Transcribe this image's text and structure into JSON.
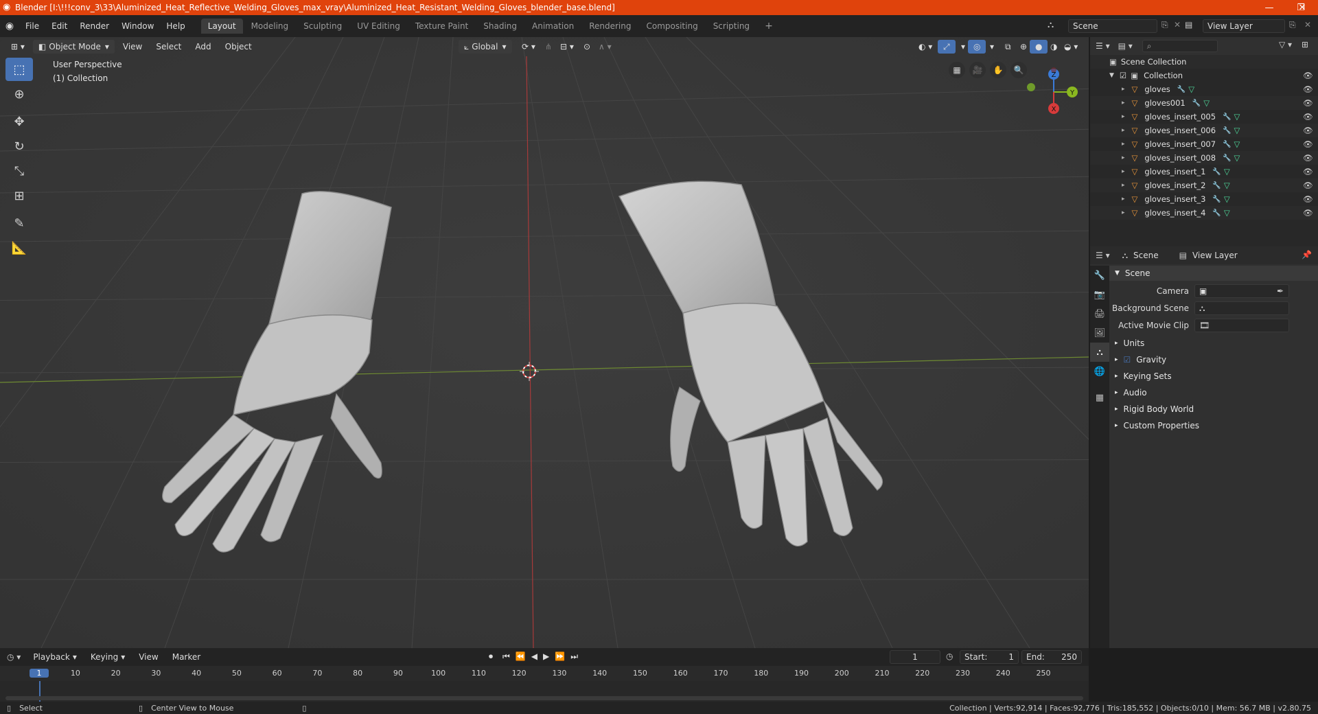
{
  "titlebar": {
    "title": "Blender [I:\\!!!conv_3\\33\\Aluminized_Heat_Reflective_Welding_Gloves_max_vray\\Aluminized_Heat_Resistant_Welding_Gloves_blender_base.blend]",
    "minimize": "—",
    "maximize": "❐",
    "close": "✕"
  },
  "menus": [
    "File",
    "Edit",
    "Render",
    "Window",
    "Help"
  ],
  "workspaces": [
    {
      "label": "Layout",
      "active": true
    },
    {
      "label": "Modeling"
    },
    {
      "label": "Sculpting"
    },
    {
      "label": "UV Editing"
    },
    {
      "label": "Texture Paint"
    },
    {
      "label": "Shading"
    },
    {
      "label": "Animation"
    },
    {
      "label": "Rendering"
    },
    {
      "label": "Compositing"
    },
    {
      "label": "Scripting"
    }
  ],
  "add_workspace": "+",
  "scene_field": "Scene",
  "view_layer_field": "View Layer",
  "viewport": {
    "mode": "Object Mode",
    "menu_view": "View",
    "menu_select": "Select",
    "menu_add": "Add",
    "menu_object": "Object",
    "orientation": "Global",
    "info_perspective": "User Perspective",
    "info_collection": "(1) Collection",
    "gizmo_x": "X",
    "gizmo_y": "Y",
    "gizmo_z": "Z"
  },
  "outliner": {
    "root": "Scene Collection",
    "collection": "Collection",
    "objects": [
      "gloves",
      "gloves001",
      "gloves_insert_005",
      "gloves_insert_006",
      "gloves_insert_007",
      "gloves_insert_008",
      "gloves_insert_1",
      "gloves_insert_2",
      "gloves_insert_3",
      "gloves_insert_4"
    ]
  },
  "properties": {
    "tab_scene": "Scene",
    "tab_view_layer": "View Layer",
    "section": "Scene",
    "camera_label": "Camera",
    "background_scene_label": "Background Scene",
    "active_movie_clip_label": "Active Movie Clip",
    "subpanels": [
      "Units",
      "Gravity",
      "Keying Sets",
      "Audio",
      "Rigid Body World",
      "Custom Properties"
    ],
    "gravity_checked": true
  },
  "timeline": {
    "playback": "Playback",
    "keying": "Keying",
    "view": "View",
    "marker": "Marker",
    "current_frame": "1",
    "start_label": "Start:",
    "start_value": "1",
    "end_label": "End:",
    "end_value": "250",
    "ruler": [
      "1",
      "10",
      "20",
      "30",
      "40",
      "50",
      "60",
      "70",
      "80",
      "90",
      "100",
      "110",
      "120",
      "130",
      "140",
      "150",
      "160",
      "170",
      "180",
      "190",
      "200",
      "210",
      "220",
      "230",
      "240",
      "250"
    ]
  },
  "status": {
    "select": "Select",
    "center_view": "Center View to Mouse",
    "stats": "Collection | Verts:92,914 | Faces:92,776 | Tris:185,552 | Objects:0/10 | Mem: 56.7 MB | v2.80.75"
  },
  "colors": {
    "title_bar": "#e0430c",
    "accent": "#4772b3",
    "object_icon": "#e8953a",
    "mesh_icon": "#4ed99b",
    "modifier_icon": "#6c9bd8"
  }
}
